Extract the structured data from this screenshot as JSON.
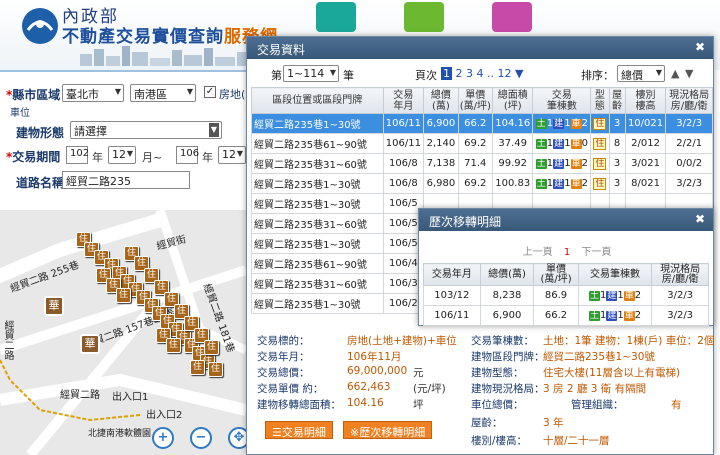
{
  "header": {
    "org": "內政部",
    "title_a": "不動產交易實價查詢",
    "title_b": "服務網"
  },
  "form": {
    "county_label": "縣市區域",
    "county_value": "臺北市",
    "district_value": "南港區",
    "house_label": "房地(",
    "unit_label": "車位",
    "type_label": "建物形態",
    "type_value": "請選擇",
    "period_label": "交易期間",
    "y1": "102",
    "m1": "12",
    "y2": "106",
    "m2": "12",
    "yearword": "年",
    "monthword": "月~",
    "monthword2": "年",
    "road_label": "道路名稱",
    "road_value": "經貿二路235"
  },
  "map": {
    "road1": "經貿二路 255巷",
    "road2": "經貿二路",
    "road3": "經貿二路 157巷36弄",
    "road4": "經貿二路",
    "road5": "經貿街",
    "road6": "經貿二路 181巷",
    "exit1": "出入口1",
    "exit2": "出入口2",
    "station": "北捷南港軟體園",
    "mark": "華",
    "house": "住"
  },
  "dialog": {
    "title": "交易資料",
    "page_label": "第",
    "page_value": "1~114",
    "page_unit": "筆",
    "pages_label": "頁次",
    "pages": [
      "1",
      "2",
      "3",
      "4",
      "..",
      "12"
    ],
    "next": "▼",
    "sort_label": "排序：",
    "sort_value": "總價",
    "columns": [
      "區段位置或區段門牌",
      "交易\n年月",
      "總價\n(萬)",
      "單價\n(萬/坪)",
      "總面積\n(坪)",
      "交易\n筆棟數",
      "型\n態",
      "屋\n齡",
      "樓別\n樓高",
      "現況格局\n房/廳/衛"
    ],
    "rows": [
      [
        "經貿二路235巷1~30號",
        "106/11",
        "6,900",
        "66.2",
        "104.16",
        "土1建1車2",
        "住",
        "3",
        "10/021",
        "3/2/3"
      ],
      [
        "經貿二路235巷61~90號",
        "106/11",
        "2,140",
        "69.2",
        "37.49",
        "土1建1車0",
        "住",
        "8",
        "2/012",
        "2/2/1"
      ],
      [
        "經貿二路235巷31~60號",
        "106/8",
        "7,138",
        "71.4",
        "99.92",
        "土1建1車2",
        "住",
        "3",
        "3/021",
        "0/0/2"
      ],
      [
        "經貿二路235巷1~30號",
        "106/8",
        "6,980",
        "69.2",
        "100.83",
        "土1建1車2",
        "住",
        "3",
        "8/021",
        "3/2/3"
      ],
      [
        "經貿二路235巷1~30號",
        "106/5",
        "",
        "",
        "",
        "",
        "",
        "",
        "",
        ""
      ],
      [
        "經貿二路235巷31~60號",
        "106/5",
        "",
        "",
        "",
        "",
        "",
        "",
        "",
        ""
      ],
      [
        "經貿二路235巷1~30號",
        "106/5",
        "",
        "",
        "",
        "",
        "",
        "",
        "",
        ""
      ],
      [
        "經貿二路235巷61~90號",
        "106/4",
        "",
        "",
        "",
        "",
        "",
        "",
        "",
        ""
      ],
      [
        "經貿二路235巷31~60號",
        "106/3",
        "",
        "",
        "",
        "",
        "",
        "",
        "",
        ""
      ],
      [
        "經貿二路235巷1~30號",
        "106/2",
        "",
        "",
        "",
        "",
        "",
        "",
        "",
        ""
      ]
    ],
    "detail": {
      "target_l": "交易標的：",
      "target_v": "房地(土地+建物)+車位",
      "date_l": "交易年月：",
      "date_v": "106年11月",
      "total_l": "交易總價：",
      "total_v": "69,000,000",
      "total_u": "元",
      "unit_l": "交易單價 約：",
      "unit_v": "662,463",
      "unit_u": "(元/坪)",
      "area_l": "建物移轉總面積：",
      "area_v": "104.16",
      "area_u": "坪",
      "cnt_l": "交易筆棟數：",
      "cnt_v": "土地：1筆 建物：1棟(戶) 車位：2個",
      "addr_l": "建物區段門牌：",
      "addr_v": "經貿二路235巷1~30號",
      "form_l": "建物型態：",
      "form_v": "住宅大樓(11層含以上有電梯)",
      "layout_l": "建物現況格局：",
      "layout_v": "3 房 2 廳 3 衛 有隔間",
      "park_l": "車位總價：",
      "mgmt_l": "管理組織：",
      "mgmt_v": "有",
      "age_l": "屋齡：",
      "age_v": "3 年",
      "floor_l": "樓別/樓高：",
      "floor_v": "十層/二十一層",
      "btn1": "交易明細",
      "btn2": "※歷次移轉明細"
    }
  },
  "history": {
    "title": "歷次移轉明細",
    "prev": "上一頁",
    "cur": "1",
    "next": "下一頁",
    "columns": [
      "交易年月",
      "總價(萬)",
      "單價\n(萬/坪)",
      "交易筆棟數",
      "現況格局\n房/廳/衛"
    ],
    "rows": [
      [
        "103/12",
        "8,238",
        "86.9",
        "土1建1車2",
        "3/2/3"
      ],
      [
        "106/11",
        "6,900",
        "66.2",
        "土1建1車2",
        "3/2/3"
      ]
    ]
  }
}
